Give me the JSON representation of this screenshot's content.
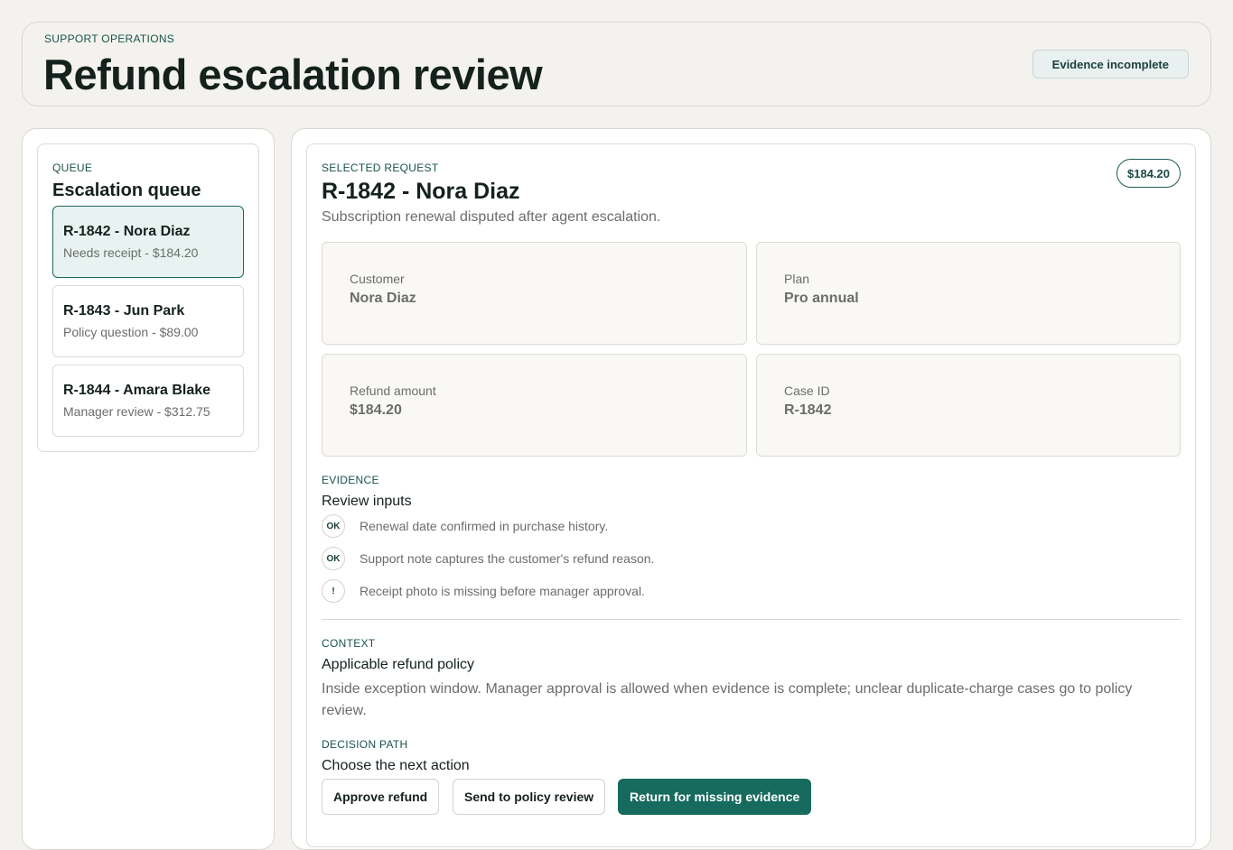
{
  "header": {
    "eyebrow": "SUPPORT OPERATIONS",
    "title": "Refund escalation review",
    "status": "Evidence incomplete"
  },
  "queue": {
    "eyebrow": "QUEUE",
    "title": "Escalation queue",
    "items": [
      {
        "title": "R-1842 - Nora Diaz",
        "sub": "Needs receipt - $184.20",
        "active": true
      },
      {
        "title": "R-1843 - Jun Park",
        "sub": "Policy question - $89.00",
        "active": false
      },
      {
        "title": "R-1844 - Amara Blake",
        "sub": "Manager review - $312.75",
        "active": false
      }
    ]
  },
  "selected": {
    "eyebrow": "SELECTED REQUEST",
    "title": "R-1842 - Nora Diaz",
    "summary": "Subscription renewal disputed after agent escalation.",
    "amount_pill": "$184.20",
    "fields": [
      {
        "label": "Customer",
        "value": "Nora Diaz"
      },
      {
        "label": "Plan",
        "value": "Pro annual"
      },
      {
        "label": "Refund amount",
        "value": "$184.20"
      },
      {
        "label": "Case ID",
        "value": "R-1842"
      }
    ]
  },
  "evidence": {
    "eyebrow": "EVIDENCE",
    "title": "Review inputs",
    "items": [
      {
        "badge": "OK",
        "text": "Renewal date confirmed in purchase history."
      },
      {
        "badge": "OK",
        "text": "Support note captures the customer's refund reason."
      },
      {
        "badge": "!",
        "text": "Receipt photo is missing before manager approval."
      }
    ]
  },
  "context": {
    "eyebrow": "CONTEXT",
    "title": "Applicable refund policy",
    "body": "Inside exception window. Manager approval is allowed when evidence is complete; unclear duplicate-charge cases go to policy review."
  },
  "decision": {
    "eyebrow": "DECISION PATH",
    "title": "Choose the next action",
    "approve": "Approve refund",
    "policy_review": "Send to policy review",
    "return_missing": "Return for missing evidence"
  },
  "colors": {
    "accent": "#166a5e",
    "active_bg": "#e8f3f1",
    "page_bg": "#f3f2ee"
  }
}
